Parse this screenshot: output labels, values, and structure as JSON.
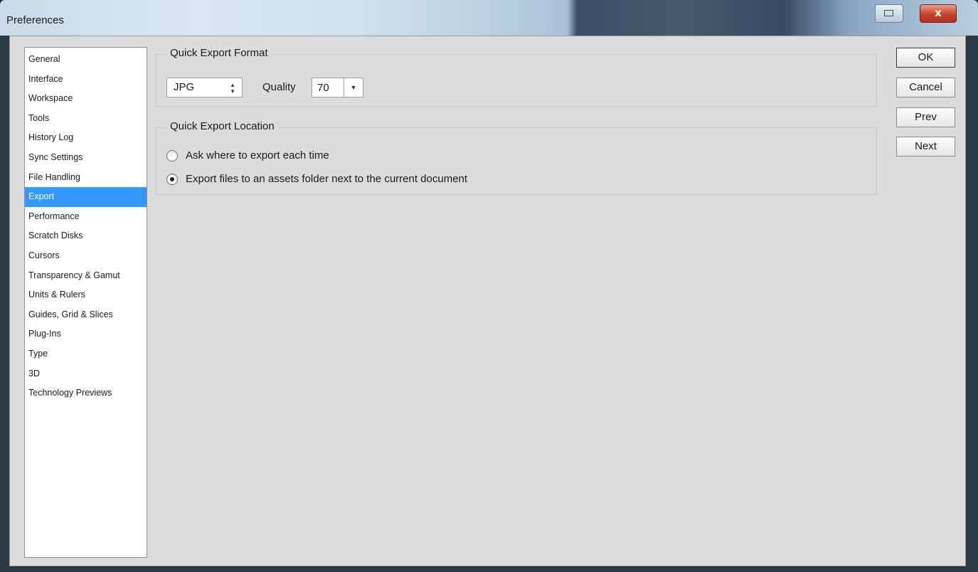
{
  "window": {
    "title": "Preferences",
    "close_glyph": "x"
  },
  "sidebar": {
    "items": [
      {
        "label": "General",
        "selected": false
      },
      {
        "label": "Interface",
        "selected": false
      },
      {
        "label": "Workspace",
        "selected": false
      },
      {
        "label": "Tools",
        "selected": false
      },
      {
        "label": "History Log",
        "selected": false
      },
      {
        "label": "Sync Settings",
        "selected": false
      },
      {
        "label": "File Handling",
        "selected": false
      },
      {
        "label": "Export",
        "selected": true
      },
      {
        "label": "Performance",
        "selected": false
      },
      {
        "label": "Scratch Disks",
        "selected": false
      },
      {
        "label": "Cursors",
        "selected": false
      },
      {
        "label": "Transparency & Gamut",
        "selected": false
      },
      {
        "label": "Units & Rulers",
        "selected": false
      },
      {
        "label": "Guides, Grid & Slices",
        "selected": false
      },
      {
        "label": "Plug-Ins",
        "selected": false
      },
      {
        "label": "Type",
        "selected": false
      },
      {
        "label": "3D",
        "selected": false
      },
      {
        "label": "Technology Previews",
        "selected": false
      }
    ]
  },
  "format_group": {
    "title": "Quick Export Format",
    "format_value": "JPG",
    "quality_label": "Quality",
    "quality_value": "70"
  },
  "location_group": {
    "title": "Quick Export Location",
    "option_ask": "Ask where to export each time",
    "option_assets": "Export files to an assets folder next to the current document",
    "selected": "assets"
  },
  "buttons": {
    "ok": "OK",
    "cancel": "Cancel",
    "prev": "Prev",
    "next": "Next"
  },
  "colors": {
    "selection": "#3399ff",
    "dialog_bg": "#dcdcdc"
  }
}
